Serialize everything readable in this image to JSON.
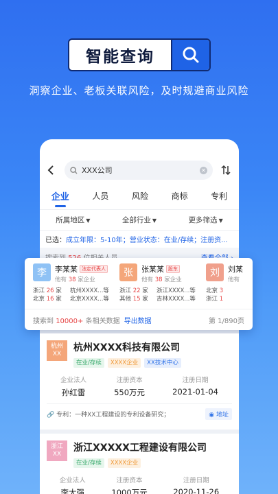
{
  "banner": {
    "title": "智能查询",
    "tagline": "洞察企业、老板关联风险，及时规避商业风险"
  },
  "search": {
    "query": "XXX公司"
  },
  "tabs": [
    "企业",
    "人员",
    "风险",
    "商标",
    "专利"
  ],
  "filters": [
    "所属地区",
    "全部行业",
    "更多筛选"
  ],
  "selected": {
    "prefix": "已选：",
    "text": "成立年限：5-10年；营业状态：在业/存续；注册资..."
  },
  "people_head": {
    "pre": "搜索到",
    "count": "526",
    "post": "位相关人员",
    "all": "查看全部"
  },
  "persons": [
    {
      "avatar": "李",
      "name": "李某某",
      "tag": "法定代表人",
      "sub_pre": "他有",
      "sub_num": "38",
      "sub_post": "家企业",
      "rows": [
        {
          "region": "浙江",
          "num": "26",
          "unit": "家",
          "company": "杭州XXXX...等"
        },
        {
          "region": "北京",
          "num": "16",
          "unit": "家",
          "company": "北京XXXX...等"
        }
      ]
    },
    {
      "avatar": "张",
      "name": "张某某",
      "tag": "股东",
      "sub_pre": "他有",
      "sub_num": "38",
      "sub_post": "家企业",
      "rows": [
        {
          "region": "浙江",
          "num": "22",
          "unit": "家",
          "company": "浙江XXXX...等"
        },
        {
          "region": "其他",
          "num": "15",
          "unit": "家",
          "company": "吉林XXXX...等"
        }
      ]
    },
    {
      "avatar": "刘",
      "name": "刘某",
      "tag": "",
      "sub_pre": "他有",
      "sub_num": "",
      "sub_post": "",
      "rows": [
        {
          "region": "北京",
          "num": "3",
          "unit": "",
          "company": ""
        },
        {
          "region": "浙江",
          "num": "1",
          "unit": "",
          "company": ""
        }
      ]
    }
  ],
  "data_foot": {
    "pre": "搜索到",
    "count": "10000+",
    "post": "条相关数据",
    "export": "导出数据",
    "page": "第 1/890页"
  },
  "companies": [
    {
      "logo": "杭州XX",
      "name": "杭州XXXX科技有限公司",
      "tags": [
        "在业/存续",
        "XXXX企业",
        "XX技术中心"
      ],
      "stats": [
        {
          "k": "企业法人",
          "v": "孙红雷"
        },
        {
          "k": "注册资本",
          "v": "550万元"
        },
        {
          "k": "注册日期",
          "v": "2021-01-04"
        }
      ],
      "patent": "专利：一种XX工程建设的专利设备研究；",
      "addr": "地址"
    },
    {
      "logo": "浙江XX",
      "name": "浙江XXXXX工程建设有限公司",
      "tags": [
        "在业/存续",
        "XXXX企业"
      ],
      "stats": [
        {
          "k": "企业法人",
          "v": "李大强"
        },
        {
          "k": "注册资本",
          "v": "1000万元"
        },
        {
          "k": "注册日期",
          "v": "2020-11-26"
        }
      ]
    }
  ],
  "colors": {
    "accent": "#1f63e6",
    "red": "#e64545",
    "avatar_li": "#8fc2f5",
    "avatar_zhang": "#f4a67a",
    "avatar_liu": "#f0a08c"
  }
}
